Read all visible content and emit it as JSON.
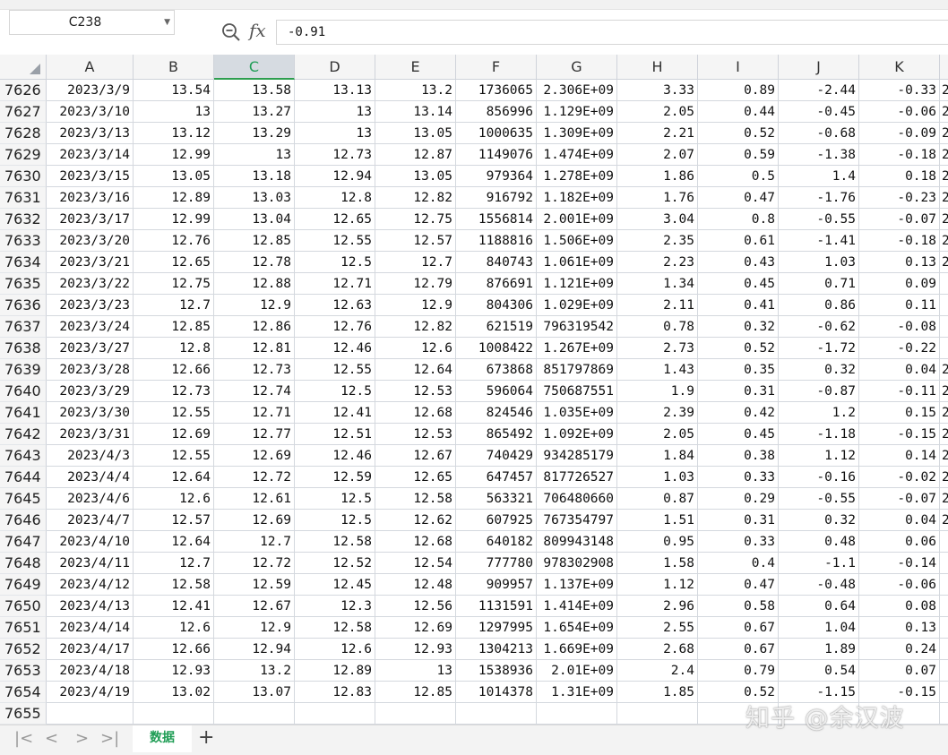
{
  "formula_bar": {
    "name_box": "C238",
    "fx": "fx",
    "formula_value": "-0.91",
    "zoom_icon": "zoom-search-icon",
    "dropdown_icon": "chevron-down-icon"
  },
  "columns": [
    "A",
    "B",
    "C",
    "D",
    "E",
    "F",
    "G",
    "H",
    "I",
    "J",
    "K",
    ""
  ],
  "selected_column": "C",
  "rows": [
    {
      "num": "7626",
      "cells": [
        "2023/3/9",
        "13.54",
        "13.58",
        "13.13",
        "13.2",
        "1736065",
        "2.306E+09",
        "3.33",
        "0.89",
        "-2.44",
        "-0.33",
        "2"
      ]
    },
    {
      "num": "7627",
      "cells": [
        "2023/3/10",
        "13",
        "13.27",
        "13",
        "13.14",
        "856996",
        "1.129E+09",
        "2.05",
        "0.44",
        "-0.45",
        "-0.06",
        "2"
      ]
    },
    {
      "num": "7628",
      "cells": [
        "2023/3/13",
        "13.12",
        "13.29",
        "13",
        "13.05",
        "1000635",
        "1.309E+09",
        "2.21",
        "0.52",
        "-0.68",
        "-0.09",
        "2"
      ]
    },
    {
      "num": "7629",
      "cells": [
        "2023/3/14",
        "12.99",
        "13",
        "12.73",
        "12.87",
        "1149076",
        "1.474E+09",
        "2.07",
        "0.59",
        "-1.38",
        "-0.18",
        "2"
      ]
    },
    {
      "num": "7630",
      "cells": [
        "2023/3/15",
        "13.05",
        "13.18",
        "12.94",
        "13.05",
        "979364",
        "1.278E+09",
        "1.86",
        "0.5",
        "1.4",
        "0.18",
        "2"
      ]
    },
    {
      "num": "7631",
      "cells": [
        "2023/3/16",
        "12.89",
        "13.03",
        "12.8",
        "12.82",
        "916792",
        "1.182E+09",
        "1.76",
        "0.47",
        "-1.76",
        "-0.23",
        "2"
      ]
    },
    {
      "num": "7632",
      "cells": [
        "2023/3/17",
        "12.99",
        "13.04",
        "12.65",
        "12.75",
        "1556814",
        "2.001E+09",
        "3.04",
        "0.8",
        "-0.55",
        "-0.07",
        "2"
      ]
    },
    {
      "num": "7633",
      "cells": [
        "2023/3/20",
        "12.76",
        "12.85",
        "12.55",
        "12.57",
        "1188816",
        "1.506E+09",
        "2.35",
        "0.61",
        "-1.41",
        "-0.18",
        "2"
      ]
    },
    {
      "num": "7634",
      "cells": [
        "2023/3/21",
        "12.65",
        "12.78",
        "12.5",
        "12.7",
        "840743",
        "1.061E+09",
        "2.23",
        "0.43",
        "1.03",
        "0.13",
        "2"
      ]
    },
    {
      "num": "7635",
      "cells": [
        "2023/3/22",
        "12.75",
        "12.88",
        "12.71",
        "12.79",
        "876691",
        "1.121E+09",
        "1.34",
        "0.45",
        "0.71",
        "0.09",
        ""
      ]
    },
    {
      "num": "7636",
      "cells": [
        "2023/3/23",
        "12.7",
        "12.9",
        "12.63",
        "12.9",
        "804306",
        "1.029E+09",
        "2.11",
        "0.41",
        "0.86",
        "0.11",
        ""
      ]
    },
    {
      "num": "7637",
      "cells": [
        "2023/3/24",
        "12.85",
        "12.86",
        "12.76",
        "12.82",
        "621519",
        "796319542",
        "0.78",
        "0.32",
        "-0.62",
        "-0.08",
        ""
      ]
    },
    {
      "num": "7638",
      "cells": [
        "2023/3/27",
        "12.8",
        "12.81",
        "12.46",
        "12.6",
        "1008422",
        "1.267E+09",
        "2.73",
        "0.52",
        "-1.72",
        "-0.22",
        ""
      ]
    },
    {
      "num": "7639",
      "cells": [
        "2023/3/28",
        "12.66",
        "12.73",
        "12.55",
        "12.64",
        "673868",
        "851797869",
        "1.43",
        "0.35",
        "0.32",
        "0.04",
        "2"
      ]
    },
    {
      "num": "7640",
      "cells": [
        "2023/3/29",
        "12.73",
        "12.74",
        "12.5",
        "12.53",
        "596064",
        "750687551",
        "1.9",
        "0.31",
        "-0.87",
        "-0.11",
        "2"
      ]
    },
    {
      "num": "7641",
      "cells": [
        "2023/3/30",
        "12.55",
        "12.71",
        "12.41",
        "12.68",
        "824546",
        "1.035E+09",
        "2.39",
        "0.42",
        "1.2",
        "0.15",
        "2"
      ]
    },
    {
      "num": "7642",
      "cells": [
        "2023/3/31",
        "12.69",
        "12.77",
        "12.51",
        "12.53",
        "865492",
        "1.092E+09",
        "2.05",
        "0.45",
        "-1.18",
        "-0.15",
        "2"
      ]
    },
    {
      "num": "7643",
      "cells": [
        "2023/4/3",
        "12.55",
        "12.69",
        "12.46",
        "12.67",
        "740429",
        "934285179",
        "1.84",
        "0.38",
        "1.12",
        "0.14",
        "2"
      ]
    },
    {
      "num": "7644",
      "cells": [
        "2023/4/4",
        "12.64",
        "12.72",
        "12.59",
        "12.65",
        "647457",
        "817726527",
        "1.03",
        "0.33",
        "-0.16",
        "-0.02",
        "2"
      ]
    },
    {
      "num": "7645",
      "cells": [
        "2023/4/6",
        "12.6",
        "12.61",
        "12.5",
        "12.58",
        "563321",
        "706480660",
        "0.87",
        "0.29",
        "-0.55",
        "-0.07",
        "2"
      ]
    },
    {
      "num": "7646",
      "cells": [
        "2023/4/7",
        "12.57",
        "12.69",
        "12.5",
        "12.62",
        "607925",
        "767354797",
        "1.51",
        "0.31",
        "0.32",
        "0.04",
        "2"
      ]
    },
    {
      "num": "7647",
      "cells": [
        "2023/4/10",
        "12.64",
        "12.7",
        "12.58",
        "12.68",
        "640182",
        "809943148",
        "0.95",
        "0.33",
        "0.48",
        "0.06",
        ""
      ]
    },
    {
      "num": "7648",
      "cells": [
        "2023/4/11",
        "12.7",
        "12.72",
        "12.52",
        "12.54",
        "777780",
        "978302908",
        "1.58",
        "0.4",
        "-1.1",
        "-0.14",
        ""
      ]
    },
    {
      "num": "7649",
      "cells": [
        "2023/4/12",
        "12.58",
        "12.59",
        "12.45",
        "12.48",
        "909957",
        "1.137E+09",
        "1.12",
        "0.47",
        "-0.48",
        "-0.06",
        ""
      ]
    },
    {
      "num": "7650",
      "cells": [
        "2023/4/13",
        "12.41",
        "12.67",
        "12.3",
        "12.56",
        "1131591",
        "1.414E+09",
        "2.96",
        "0.58",
        "0.64",
        "0.08",
        ""
      ]
    },
    {
      "num": "7651",
      "cells": [
        "2023/4/14",
        "12.6",
        "12.9",
        "12.58",
        "12.69",
        "1297995",
        "1.654E+09",
        "2.55",
        "0.67",
        "1.04",
        "0.13",
        ""
      ]
    },
    {
      "num": "7652",
      "cells": [
        "2023/4/17",
        "12.66",
        "12.94",
        "12.6",
        "12.93",
        "1304213",
        "1.669E+09",
        "2.68",
        "0.67",
        "1.89",
        "0.24",
        ""
      ]
    },
    {
      "num": "7653",
      "cells": [
        "2023/4/18",
        "12.93",
        "13.2",
        "12.89",
        "13",
        "1538936",
        "2.01E+09",
        "2.4",
        "0.79",
        "0.54",
        "0.07",
        ""
      ]
    },
    {
      "num": "7654",
      "cells": [
        "2023/4/19",
        "13.02",
        "13.07",
        "12.83",
        "12.85",
        "1014378",
        "1.31E+09",
        "1.85",
        "0.52",
        "-1.15",
        "-0.15",
        ""
      ]
    },
    {
      "num": "7655",
      "cells": [
        "",
        "",
        "",
        "",
        "",
        "",
        "",
        "",
        "",
        "",
        "",
        ""
      ]
    }
  ],
  "tabs": {
    "nav_first": "|<",
    "nav_prev": "<",
    "nav_next": ">",
    "nav_last": ">|",
    "sheet_name": "数据",
    "add": "+"
  },
  "watermark": "知乎 @余汉波"
}
